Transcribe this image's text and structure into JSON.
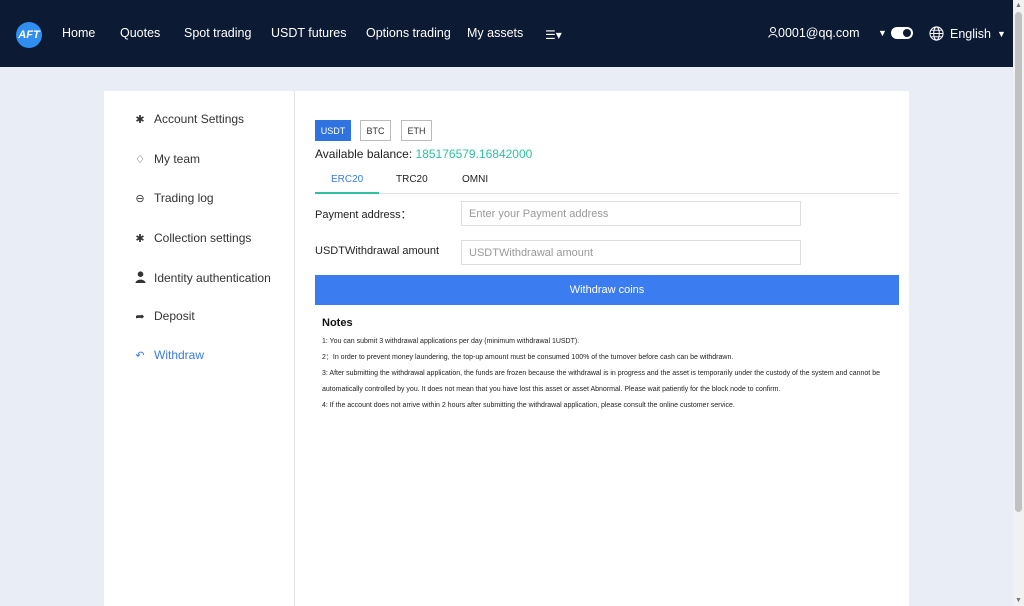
{
  "header": {
    "logo_text": "AFT",
    "nav": [
      "Home",
      "Quotes",
      "Spot trading",
      "USDT futures",
      "Options trading",
      "My assets"
    ],
    "user": "0001@qq.com",
    "language": "English"
  },
  "sidebar": {
    "items": [
      {
        "label": "Account Settings",
        "icon": "gear-icon"
      },
      {
        "label": "My team",
        "icon": "diamond-icon"
      },
      {
        "label": "Trading log",
        "icon": "log-icon"
      },
      {
        "label": "Collection settings",
        "icon": "gear-icon"
      },
      {
        "label": "Identity authentication",
        "icon": "user-icon"
      },
      {
        "label": "Deposit",
        "icon": "share-arrow-icon"
      },
      {
        "label": "Withdraw",
        "icon": "reply-arrow-icon"
      }
    ],
    "active_index": 6
  },
  "main": {
    "coins": [
      "USDT",
      "BTC",
      "ETH"
    ],
    "selected_coin": "USDT",
    "balance_label": "Available balance:",
    "balance_value": "185176579.16842000",
    "tabs": [
      "ERC20",
      "TRC20",
      "OMNI"
    ],
    "selected_tab": "ERC20",
    "address_label": "Payment address：",
    "address_placeholder": "Enter your Payment address",
    "amount_label": "USDTWithdrawal amount",
    "amount_placeholder": "USDTWithdrawal amount",
    "withdraw_button": "Withdraw coins",
    "notes_title": "Notes",
    "notes": [
      "1: You can submit 3 withdrawal applications per day (minimum withdrawal 1USDT).",
      "2：In order to prevent money laundering, the top-up amount must be consumed 100% of the turnover before cash can be withdrawn.",
      "3: After submitting the withdrawal application, the funds are frozen because the withdrawal is in progress and the asset is temporarily under the custody of the system and cannot be automatically controlled by you. It does not mean that you have lost this asset or asset Abnormal. Please wait patiently for the block node to confirm.",
      "4: If the account does not arrive within 2 hours after submitting the withdrawal application, please consult the online customer service."
    ]
  },
  "colors": {
    "nav_bg": "#0c1a33",
    "accent": "#3b7cf0",
    "balance": "#2ec0a0",
    "page_bg": "#e9edf5"
  }
}
